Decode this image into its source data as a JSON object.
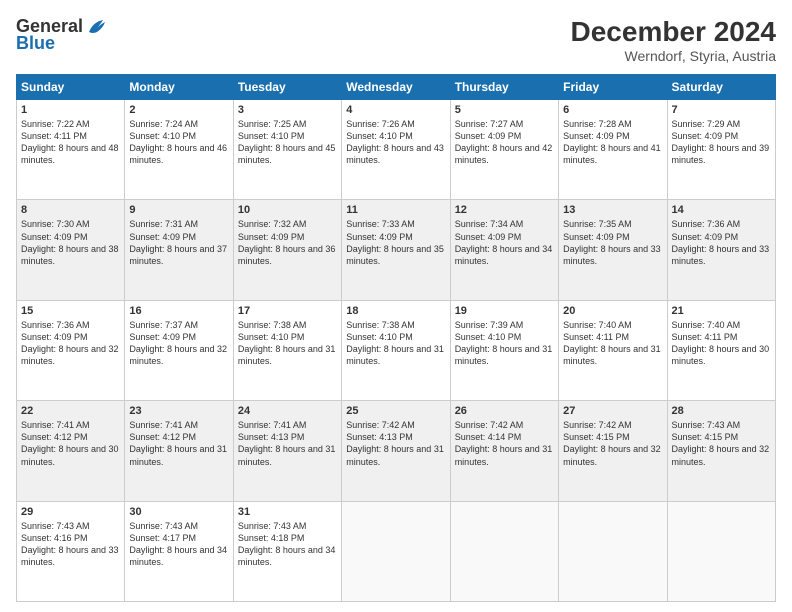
{
  "header": {
    "logo_general": "General",
    "logo_blue": "Blue",
    "month_year": "December 2024",
    "location": "Werndorf, Styria, Austria"
  },
  "days_of_week": [
    "Sunday",
    "Monday",
    "Tuesday",
    "Wednesday",
    "Thursday",
    "Friday",
    "Saturday"
  ],
  "weeks": [
    [
      {
        "day": "1",
        "sunrise": "7:22 AM",
        "sunset": "4:11 PM",
        "daylight": "8 hours and 48 minutes."
      },
      {
        "day": "2",
        "sunrise": "7:24 AM",
        "sunset": "4:10 PM",
        "daylight": "8 hours and 46 minutes."
      },
      {
        "day": "3",
        "sunrise": "7:25 AM",
        "sunset": "4:10 PM",
        "daylight": "8 hours and 45 minutes."
      },
      {
        "day": "4",
        "sunrise": "7:26 AM",
        "sunset": "4:10 PM",
        "daylight": "8 hours and 43 minutes."
      },
      {
        "day": "5",
        "sunrise": "7:27 AM",
        "sunset": "4:09 PM",
        "daylight": "8 hours and 42 minutes."
      },
      {
        "day": "6",
        "sunrise": "7:28 AM",
        "sunset": "4:09 PM",
        "daylight": "8 hours and 41 minutes."
      },
      {
        "day": "7",
        "sunrise": "7:29 AM",
        "sunset": "4:09 PM",
        "daylight": "8 hours and 39 minutes."
      }
    ],
    [
      {
        "day": "8",
        "sunrise": "7:30 AM",
        "sunset": "4:09 PM",
        "daylight": "8 hours and 38 minutes."
      },
      {
        "day": "9",
        "sunrise": "7:31 AM",
        "sunset": "4:09 PM",
        "daylight": "8 hours and 37 minutes."
      },
      {
        "day": "10",
        "sunrise": "7:32 AM",
        "sunset": "4:09 PM",
        "daylight": "8 hours and 36 minutes."
      },
      {
        "day": "11",
        "sunrise": "7:33 AM",
        "sunset": "4:09 PM",
        "daylight": "8 hours and 35 minutes."
      },
      {
        "day": "12",
        "sunrise": "7:34 AM",
        "sunset": "4:09 PM",
        "daylight": "8 hours and 34 minutes."
      },
      {
        "day": "13",
        "sunrise": "7:35 AM",
        "sunset": "4:09 PM",
        "daylight": "8 hours and 33 minutes."
      },
      {
        "day": "14",
        "sunrise": "7:36 AM",
        "sunset": "4:09 PM",
        "daylight": "8 hours and 33 minutes."
      }
    ],
    [
      {
        "day": "15",
        "sunrise": "7:36 AM",
        "sunset": "4:09 PM",
        "daylight": "8 hours and 32 minutes."
      },
      {
        "day": "16",
        "sunrise": "7:37 AM",
        "sunset": "4:09 PM",
        "daylight": "8 hours and 32 minutes."
      },
      {
        "day": "17",
        "sunrise": "7:38 AM",
        "sunset": "4:10 PM",
        "daylight": "8 hours and 31 minutes."
      },
      {
        "day": "18",
        "sunrise": "7:38 AM",
        "sunset": "4:10 PM",
        "daylight": "8 hours and 31 minutes."
      },
      {
        "day": "19",
        "sunrise": "7:39 AM",
        "sunset": "4:10 PM",
        "daylight": "8 hours and 31 minutes."
      },
      {
        "day": "20",
        "sunrise": "7:40 AM",
        "sunset": "4:11 PM",
        "daylight": "8 hours and 31 minutes."
      },
      {
        "day": "21",
        "sunrise": "7:40 AM",
        "sunset": "4:11 PM",
        "daylight": "8 hours and 30 minutes."
      }
    ],
    [
      {
        "day": "22",
        "sunrise": "7:41 AM",
        "sunset": "4:12 PM",
        "daylight": "8 hours and 30 minutes."
      },
      {
        "day": "23",
        "sunrise": "7:41 AM",
        "sunset": "4:12 PM",
        "daylight": "8 hours and 31 minutes."
      },
      {
        "day": "24",
        "sunrise": "7:41 AM",
        "sunset": "4:13 PM",
        "daylight": "8 hours and 31 minutes."
      },
      {
        "day": "25",
        "sunrise": "7:42 AM",
        "sunset": "4:13 PM",
        "daylight": "8 hours and 31 minutes."
      },
      {
        "day": "26",
        "sunrise": "7:42 AM",
        "sunset": "4:14 PM",
        "daylight": "8 hours and 31 minutes."
      },
      {
        "day": "27",
        "sunrise": "7:42 AM",
        "sunset": "4:15 PM",
        "daylight": "8 hours and 32 minutes."
      },
      {
        "day": "28",
        "sunrise": "7:43 AM",
        "sunset": "4:15 PM",
        "daylight": "8 hours and 32 minutes."
      }
    ],
    [
      {
        "day": "29",
        "sunrise": "7:43 AM",
        "sunset": "4:16 PM",
        "daylight": "8 hours and 33 minutes."
      },
      {
        "day": "30",
        "sunrise": "7:43 AM",
        "sunset": "4:17 PM",
        "daylight": "8 hours and 34 minutes."
      },
      {
        "day": "31",
        "sunrise": "7:43 AM",
        "sunset": "4:18 PM",
        "daylight": "8 hours and 34 minutes."
      },
      null,
      null,
      null,
      null
    ]
  ]
}
